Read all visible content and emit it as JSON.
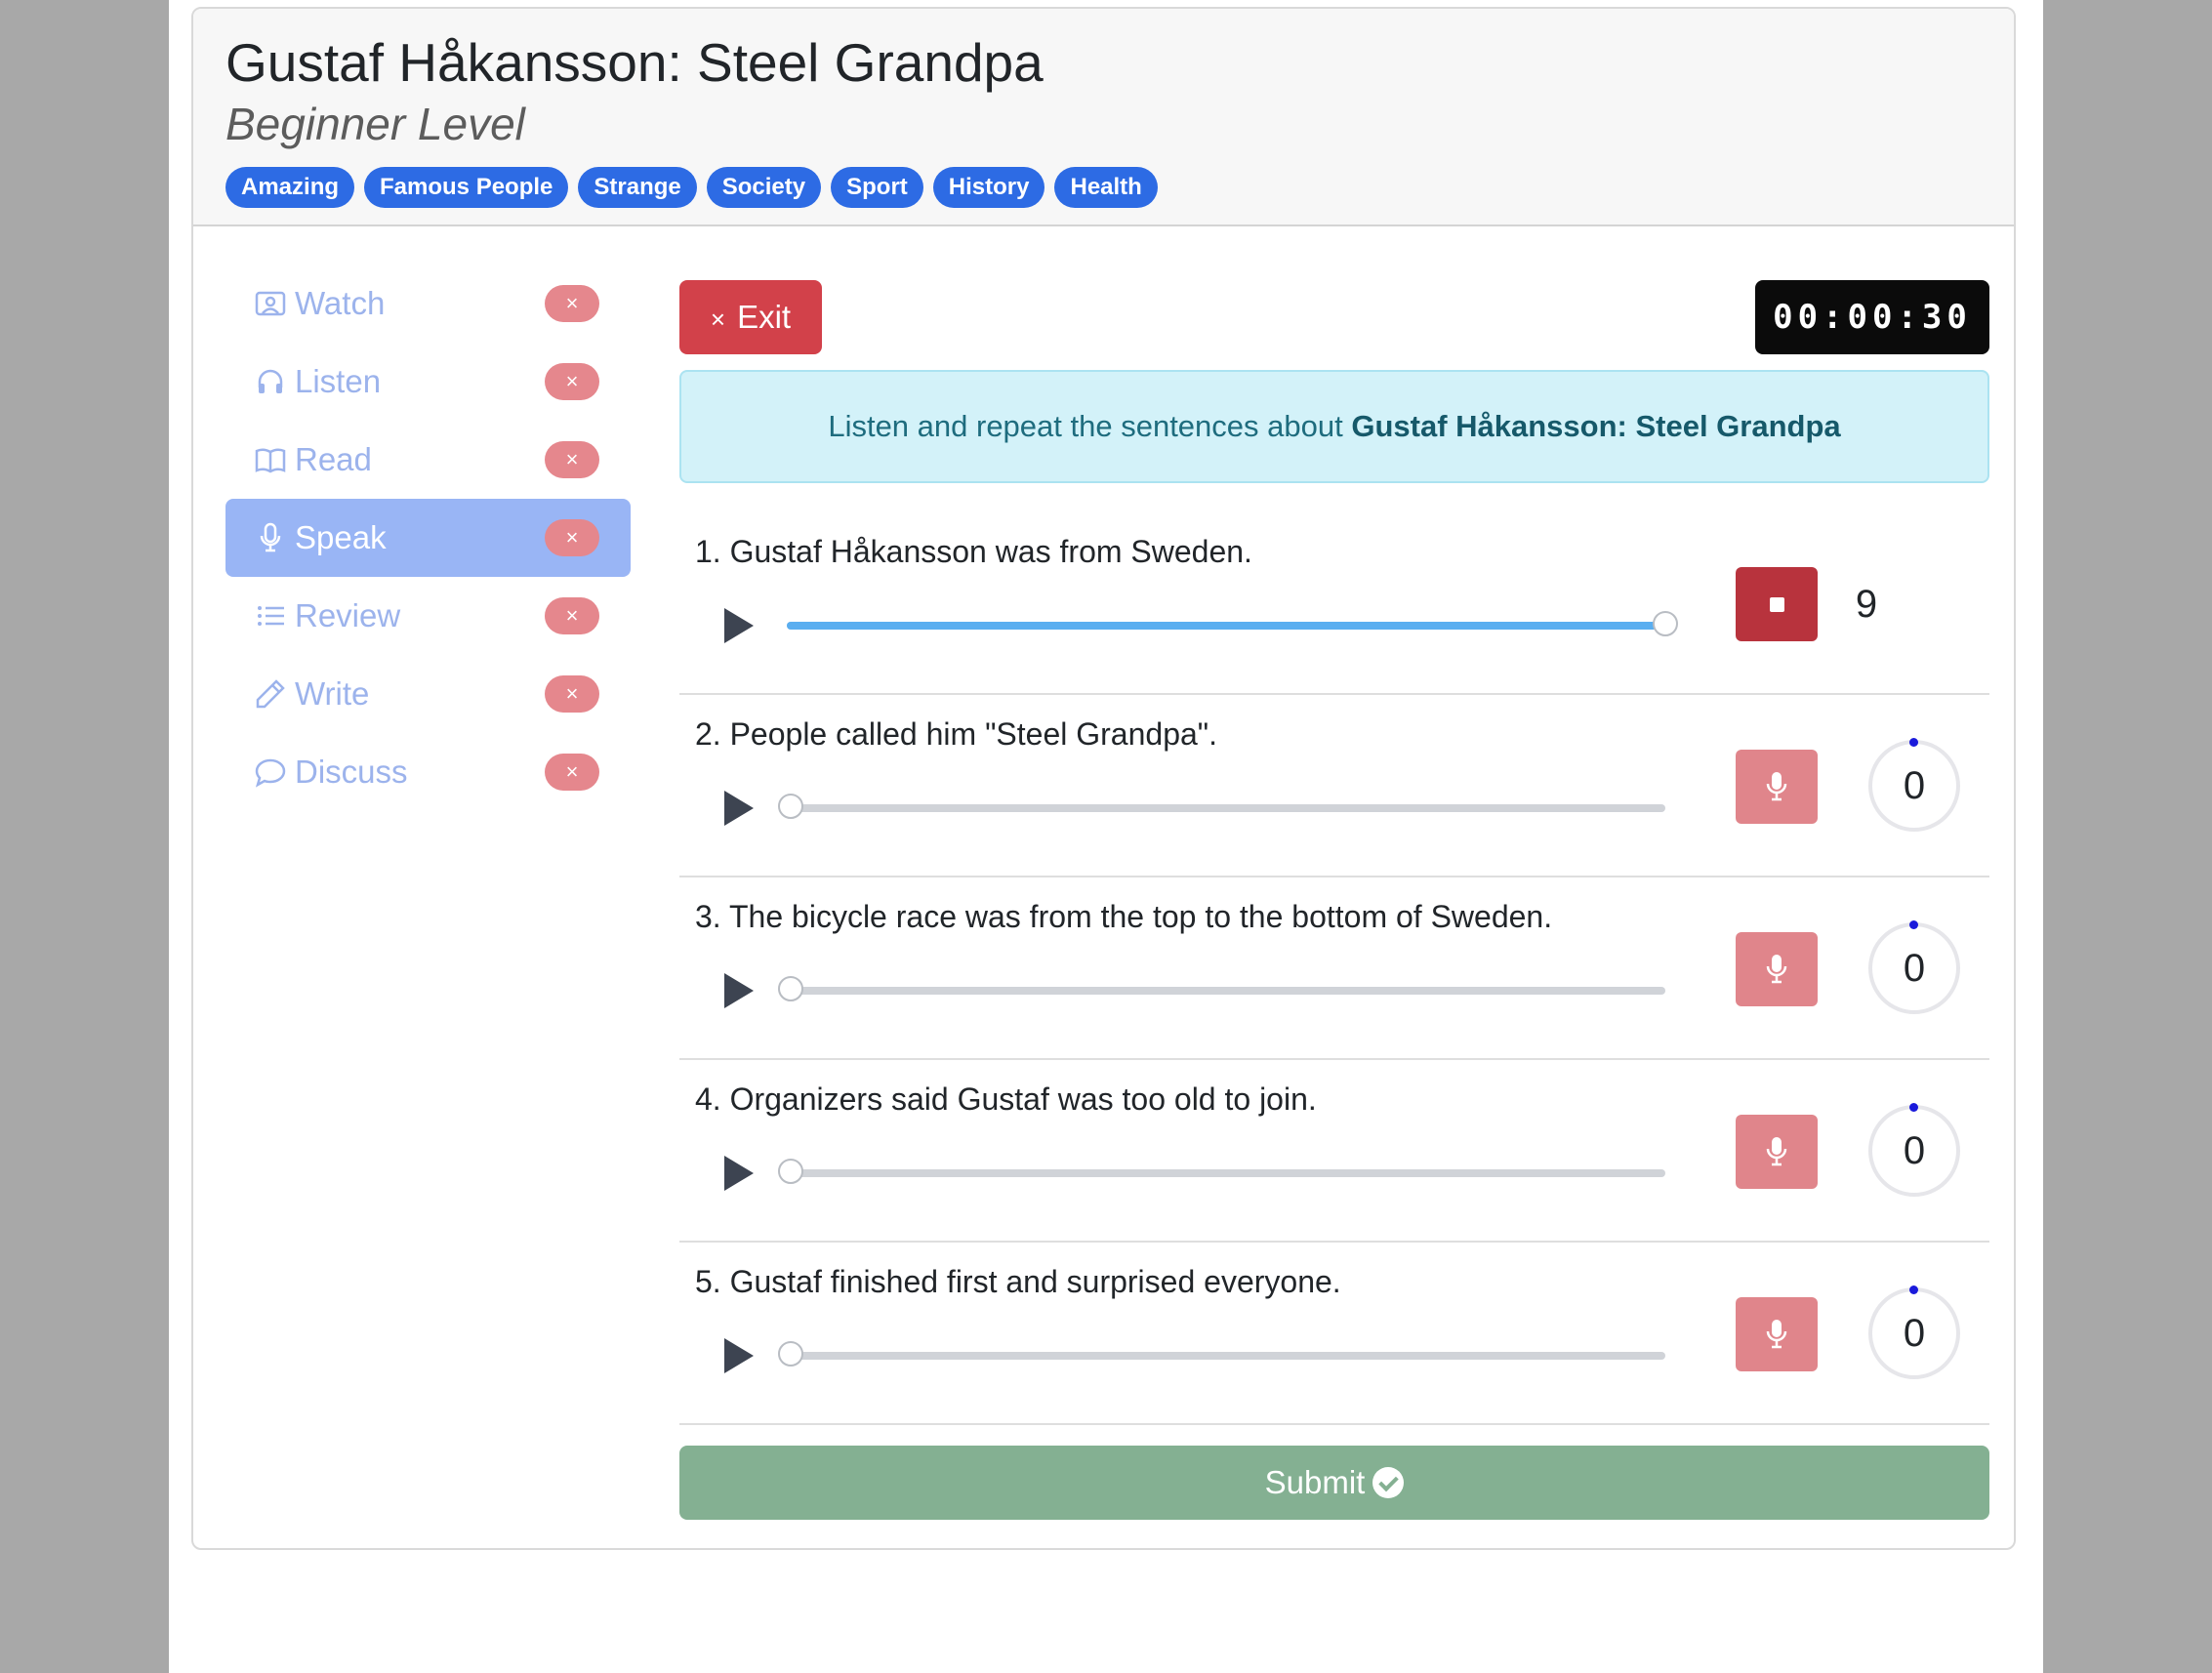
{
  "lesson": {
    "title": "Gustaf Håkansson: Steel Grandpa",
    "level": "Beginner Level",
    "tags": [
      "Amazing",
      "Famous People",
      "Strange",
      "Society",
      "Sport",
      "History",
      "Health"
    ]
  },
  "sidebar": {
    "items": [
      {
        "label": "Watch",
        "icon": "person-video-icon",
        "badge": "×",
        "active": false
      },
      {
        "label": "Listen",
        "icon": "headphones-icon",
        "badge": "×",
        "active": false
      },
      {
        "label": "Read",
        "icon": "book-icon",
        "badge": "×",
        "active": false
      },
      {
        "label": "Speak",
        "icon": "microphone-icon",
        "badge": "×",
        "active": true
      },
      {
        "label": "Review",
        "icon": "list-icon",
        "badge": "×",
        "active": false
      },
      {
        "label": "Write",
        "icon": "pencil-icon",
        "badge": "×",
        "active": false
      },
      {
        "label": "Discuss",
        "icon": "chat-bubble-icon",
        "badge": "×",
        "active": false
      }
    ]
  },
  "toolbar": {
    "exit_icon": "×",
    "exit_label": "Exit",
    "timer": "00:00:30"
  },
  "instruction": {
    "prefix": "Listen and repeat the sentences about ",
    "subject": "Gustaf Håkansson: Steel Grandpa"
  },
  "sentences": [
    {
      "text": "1. Gustaf Håkansson was from Sweden.",
      "progress": 1.0,
      "recording": true,
      "score": "9"
    },
    {
      "text": "2. People called him \"Steel Grandpa\".",
      "progress": 0.0,
      "recording": false,
      "score": "0"
    },
    {
      "text": "3. The bicycle race was from the top to the bottom of Sweden.",
      "progress": 0.0,
      "recording": false,
      "score": "0"
    },
    {
      "text": "4. Organizers said Gustaf was too old to join.",
      "progress": 0.0,
      "recording": false,
      "score": "0"
    },
    {
      "text": "5. Gustaf finished first and surprised everyone.",
      "progress": 0.0,
      "recording": false,
      "score": "0"
    }
  ],
  "submit": {
    "label": "Submit"
  },
  "colors": {
    "accent": "#2d6be4",
    "danger": "#d2414a",
    "success": "#84b092",
    "info_bg": "#d3f2f9"
  }
}
